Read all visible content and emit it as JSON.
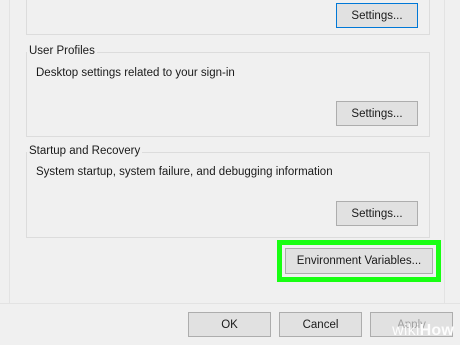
{
  "performance": {
    "settings_label": "Settings..."
  },
  "user_profiles": {
    "title": "User Profiles",
    "description": "Desktop settings related to your sign-in",
    "settings_label": "Settings..."
  },
  "startup_recovery": {
    "title": "Startup and Recovery",
    "description": "System startup, system failure, and debugging information",
    "settings_label": "Settings..."
  },
  "environment_variables_label": "Environment Variables...",
  "footer": {
    "ok_label": "OK",
    "cancel_label": "Cancel",
    "apply_label": "Apply"
  },
  "watermark": {
    "part1": "wiki",
    "part2": "How"
  },
  "colors": {
    "highlight": "#18ff12",
    "focus": "#0078d7"
  }
}
